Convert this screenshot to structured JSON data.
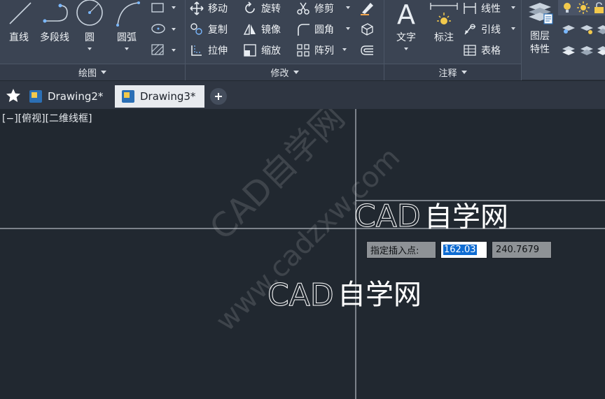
{
  "ribbon": {
    "draw": {
      "title": "绘图",
      "line": "直线",
      "polyline": "多段线",
      "circle": "圆",
      "arc": "圆弧"
    },
    "modify": {
      "title": "修改",
      "move": "移动",
      "rotate": "旋转",
      "trim": "修剪",
      "copy": "复制",
      "mirror": "镜像",
      "fillet": "圆角",
      "stretch": "拉伸",
      "scale": "缩放",
      "array": "阵列"
    },
    "annotation": {
      "title": "注释",
      "text": "文字",
      "dimension": "标注",
      "linear": "线性",
      "leader": "引线",
      "table": "表格"
    },
    "layers": {
      "label": "图层特性",
      "label_line1": "图层",
      "label_line2": "特性"
    }
  },
  "tabs": [
    {
      "label": "Drawing2*",
      "active": false
    },
    {
      "label": "Drawing3*",
      "active": true
    }
  ],
  "canvas": {
    "viewport_label": "[−][俯视][二维线框]",
    "watermark_line1": "CAD自学网",
    "watermark_line2": "www.cadzxw.com",
    "placed_text_latin": "CAD",
    "placed_text_cjk": "自学网",
    "preview_text_latin": "CAD",
    "preview_text_cjk": "自学网",
    "insert_prompt": "指定插入点:",
    "insert_x": "162.03",
    "insert_y": "240.7679"
  },
  "colors": {
    "ribbon_bg": "#3b4453",
    "canvas_bg": "#212830",
    "selection": "#0f6cd2",
    "star": "#ffffff",
    "accent_yellow": "#f2c94c"
  }
}
